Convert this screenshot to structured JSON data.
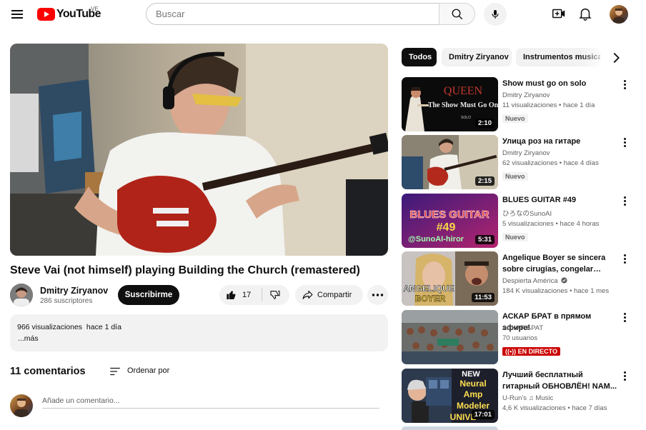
{
  "header": {
    "logo_text": "YouTube",
    "country_code": "VE",
    "search_placeholder": "Buscar"
  },
  "video": {
    "title": "Steve Vai (not himself) playing Building the Church (remastered)",
    "channel": "Dmitry Ziryanov",
    "subscribers": "286 suscriptores",
    "subscribe_label": "Suscribirme",
    "likes": "17",
    "share_label": "Compartir",
    "description_meta": "966 visualizaciones  hace 1 día",
    "description_more": "...más"
  },
  "comments": {
    "count_label": "11 comentarios",
    "sort_label": "Ordenar por",
    "input_placeholder": "Añade un comentario..."
  },
  "chips": [
    {
      "label": "Todos",
      "active": true
    },
    {
      "label": "Dmitry Ziryanov",
      "active": false
    },
    {
      "label": "Instrumentos musical",
      "active": false
    }
  ],
  "recommendations": [
    {
      "title": "Show must go on solo",
      "channel": "Dmitry Ziryanov",
      "meta": "11 visualizaciones  • hace 1 día",
      "duration": "2:10",
      "badge": "Nuevo"
    },
    {
      "title": "Улица роз на гитаре",
      "channel": "Dmitry Ziryanov",
      "meta": "62 visualizaciones  • hace 4 días",
      "duration": "2:15",
      "badge": "Nuevo"
    },
    {
      "title": "BLUES GUITAR #49",
      "channel": "ひろなのSunoAI",
      "meta": "5 visualizaciones  • hace 4 horas",
      "duration": "5:31",
      "badge": "Nuevo"
    },
    {
      "title": "Angelique Boyer se sincera sobre cirugías, congelar óvulos...",
      "channel": "Despierta América",
      "meta": "184 K visualizaciones  • hace 1 mes",
      "duration": "11:53",
      "badge": ""
    },
    {
      "title": "АСКАР БРАТ в прямом эфире!",
      "channel": "АСКАР БРАТ",
      "meta": "70 usuarios",
      "duration": "",
      "badge": "",
      "live": "EN DIRECTO"
    },
    {
      "title": "Лучший бесплатный гитарный ОБНОВЛЁН! NAM...",
      "channel": "U-Run's ♫ Music",
      "meta": "4,6 K visualizaciones  • hace 7 días",
      "duration": "17:01",
      "badge": ""
    }
  ],
  "thumb_text": {
    "queen_logo": "QUEEN",
    "queen_sub": "The Show Must Go On",
    "queen_small": "SOLO",
    "blues_title": "BLUES GUITAR",
    "blues_num": "#49",
    "blues_handle": "@SunoAI-hiror",
    "angelique_name": "ANGELIQUE",
    "angelique_last": "BOYER",
    "nam_line1": "NEW",
    "nam_line2": "Neural",
    "nam_line3": "Amp",
    "nam_line4": "Modeler",
    "nam_line5": "UNIVE"
  },
  "colors": {
    "brand_red": "#ff0000",
    "live_red": "#cc0000",
    "text_primary": "#0f0f0f",
    "text_secondary": "#606060",
    "chip_bg": "#f2f2f2"
  }
}
